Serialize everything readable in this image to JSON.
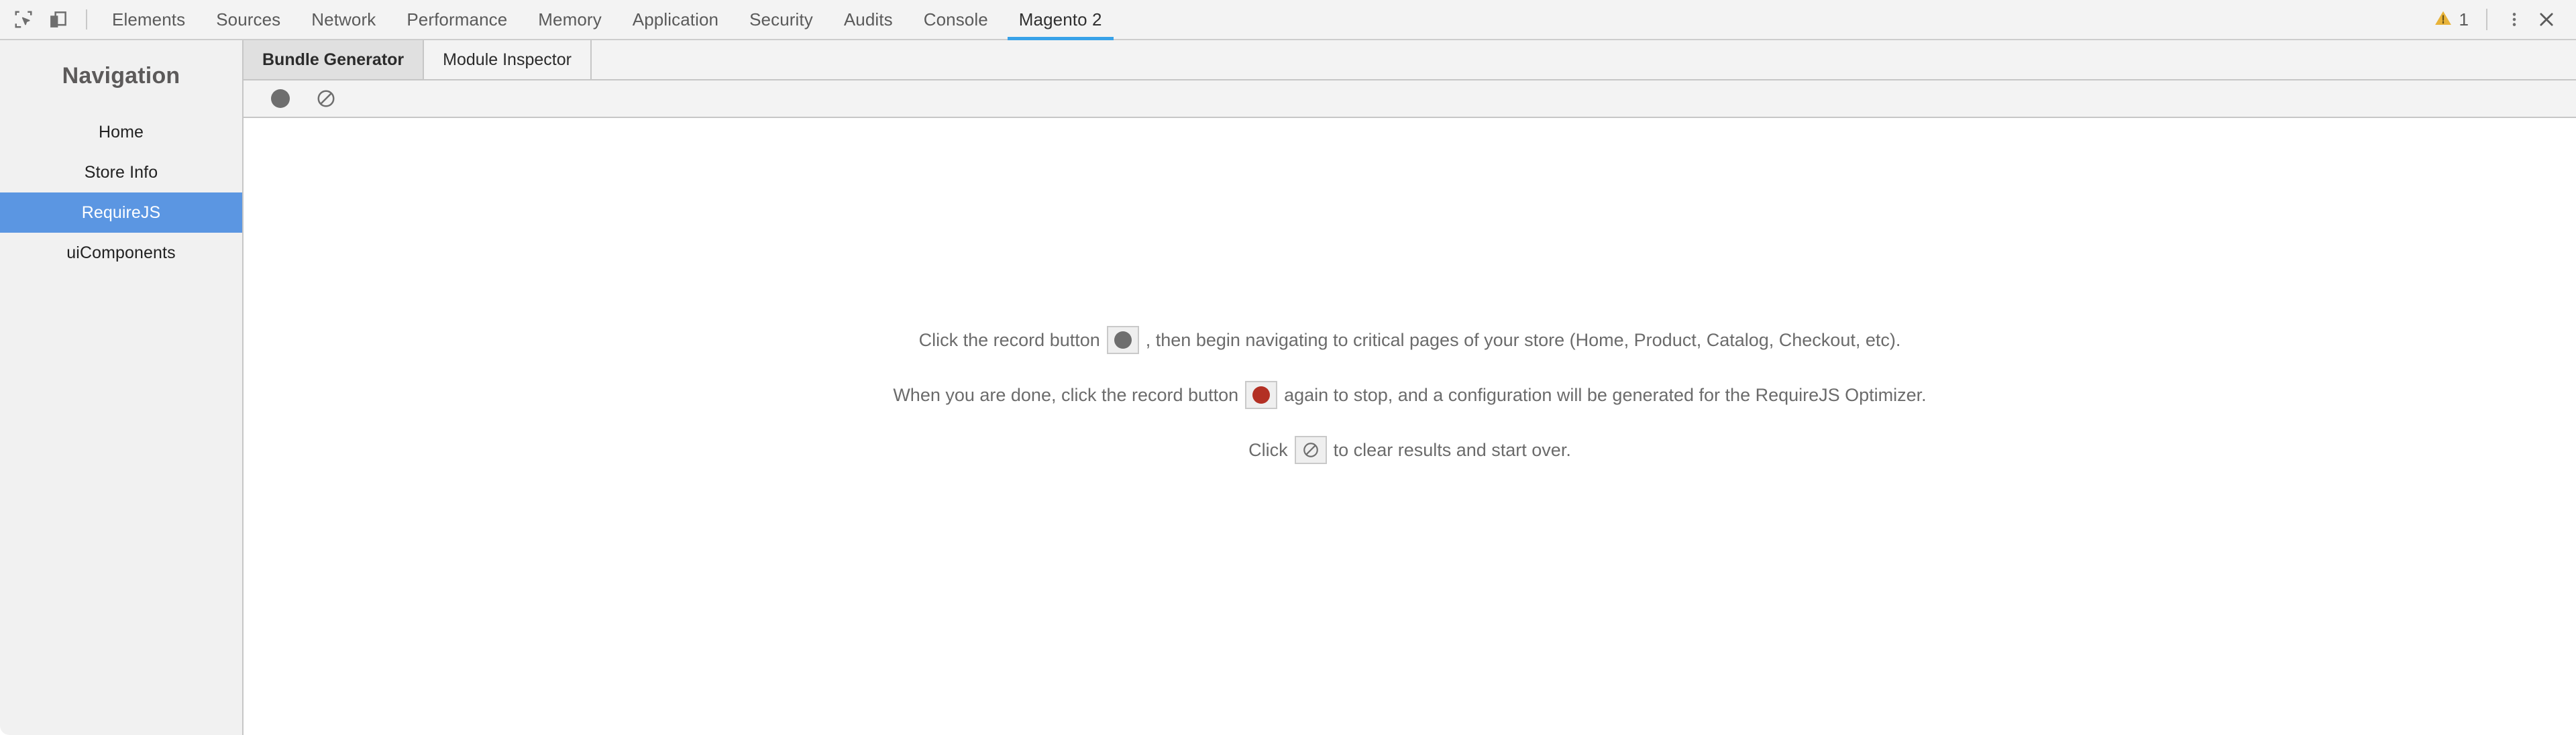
{
  "devtools": {
    "left_icons": [
      {
        "name": "inspect-element-icon",
        "title": "Inspect element"
      },
      {
        "name": "device-toolbar-icon",
        "title": "Toggle device toolbar"
      }
    ],
    "tabs": [
      {
        "label": "Elements",
        "active": false
      },
      {
        "label": "Sources",
        "active": false
      },
      {
        "label": "Network",
        "active": false
      },
      {
        "label": "Performance",
        "active": false
      },
      {
        "label": "Memory",
        "active": false
      },
      {
        "label": "Application",
        "active": false
      },
      {
        "label": "Security",
        "active": false
      },
      {
        "label": "Audits",
        "active": false
      },
      {
        "label": "Console",
        "active": false
      },
      {
        "label": "Magento 2",
        "active": true
      }
    ],
    "active_tab": "Magento 2",
    "warning_count": "1",
    "warning_icon": "warning-triangle-icon",
    "more_icon": "kebab-menu-icon",
    "close_icon": "close-icon",
    "accent_color": "#38a2e8",
    "warning_color": "#e8b339"
  },
  "sidebar": {
    "title": "Navigation",
    "items": [
      {
        "label": "Home",
        "active": false
      },
      {
        "label": "Store Info",
        "active": false
      },
      {
        "label": "RequireJS",
        "active": true
      },
      {
        "label": "uiComponents",
        "active": false
      }
    ],
    "active_item": "RequireJS",
    "active_color": "#5b96e2"
  },
  "panel": {
    "subtabs": [
      {
        "label": "Bundle Generator",
        "active": true
      },
      {
        "label": "Module Inspector",
        "active": false
      }
    ],
    "active_subtab": "Bundle Generator",
    "toolbar": {
      "record_button_name": "record-button",
      "record_button_title": "Record",
      "clear_button_name": "clear-button",
      "clear_button_title": "Clear"
    },
    "help": {
      "line1_before": "Click the record button",
      "line1_after": ", then begin navigating to critical pages of your store (Home, Product, Catalog, Checkout, etc).",
      "line2_before": "When you are done, click the record button",
      "line2_after": "again to stop, and a configuration will be generated for the RequireJS Optimizer.",
      "line3_before": "Click",
      "line3_after": "to clear results and start over."
    }
  },
  "colors": {
    "record_gray": "#6e6e6e",
    "record_red": "#b33024",
    "panel_bg": "#f3f3f3",
    "sidebar_bg": "#f1f1f1"
  }
}
